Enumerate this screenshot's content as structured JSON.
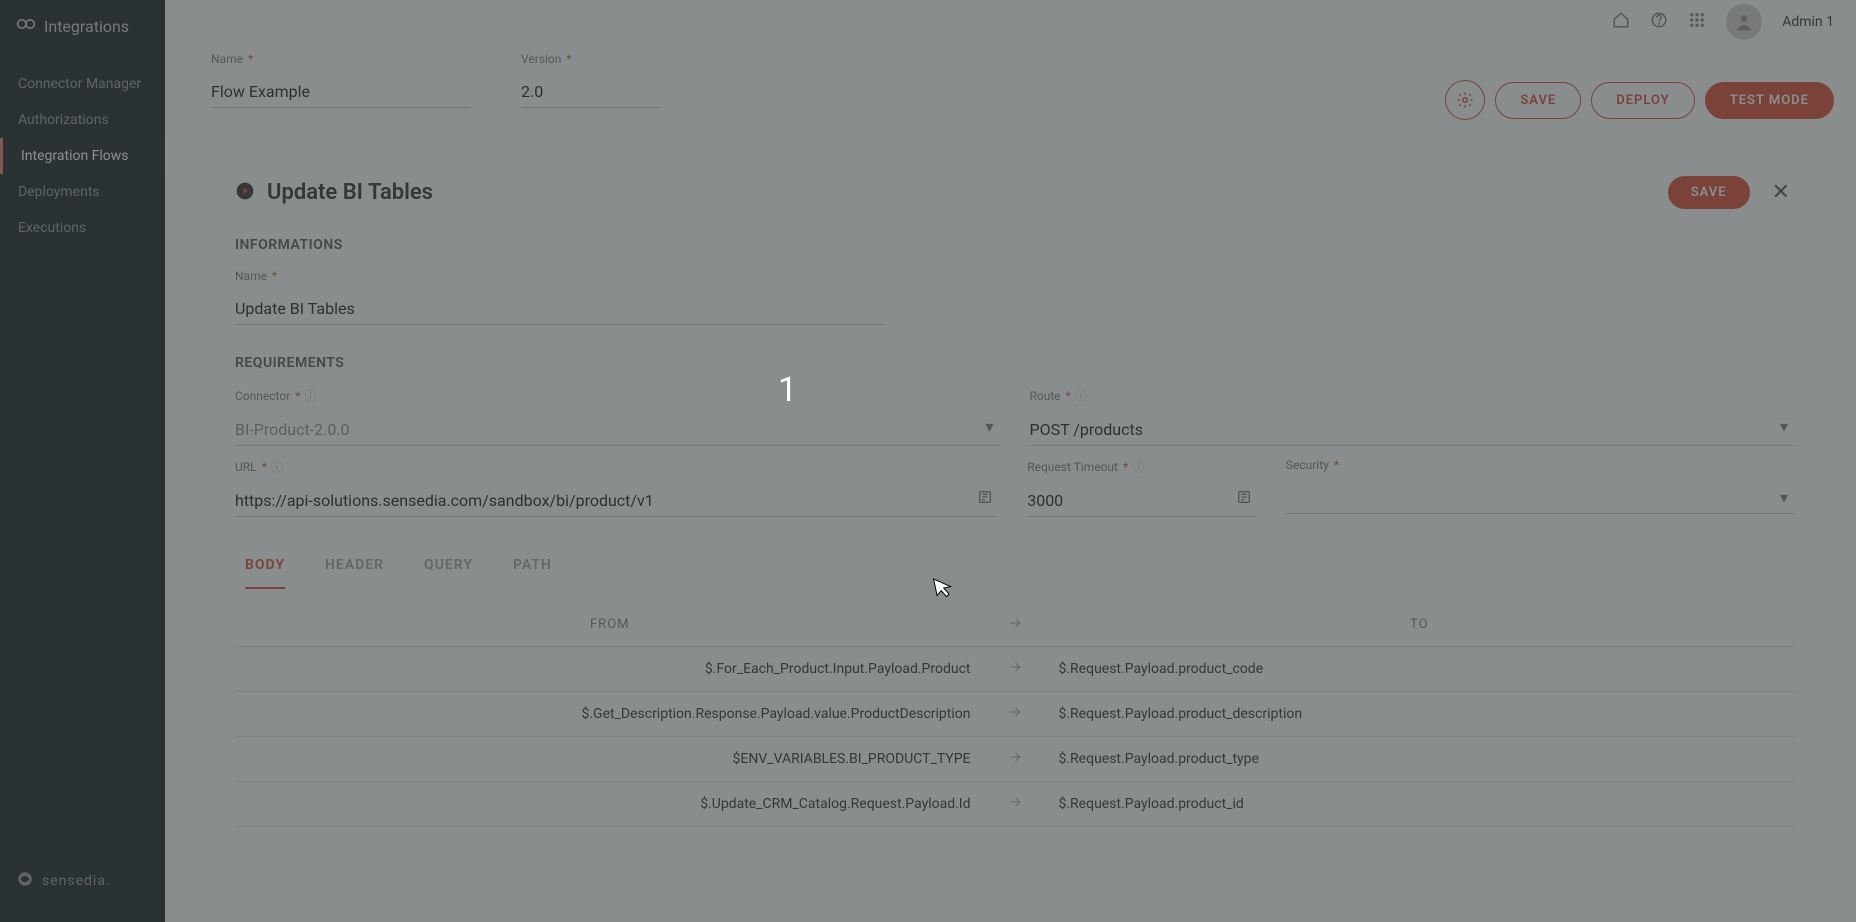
{
  "brand": {
    "name": "Integrations",
    "footer": "sensedia."
  },
  "sidebar": {
    "items": [
      {
        "label": "Connector Manager"
      },
      {
        "label": "Authorizations"
      },
      {
        "label": "Integration Flows"
      },
      {
        "label": "Deployments"
      },
      {
        "label": "Executions"
      }
    ]
  },
  "topbar": {
    "user": "Admin 1"
  },
  "header": {
    "name_label": "Name",
    "name_value": "Flow Example",
    "version_label": "Version",
    "version_value": "2.0",
    "save": "SAVE",
    "deploy": "DEPLOY",
    "test_mode": "TEST MODE"
  },
  "panel": {
    "title": "Update BI Tables",
    "save": "SAVE",
    "informations": {
      "heading": "INFORMATIONS",
      "name_label": "Name",
      "name_value": "Update BI Tables"
    },
    "requirements": {
      "heading": "REQUIREMENTS",
      "connector_label": "Connector",
      "connector_value": "BI-Product-2.0.0",
      "route_label": "Route",
      "route_value": "POST /products",
      "url_label": "URL",
      "url_value": "https://api-solutions.sensedia.com/sandbox/bi/product/v1",
      "timeout_label": "Request Timeout",
      "timeout_value": "3000",
      "security_label": "Security",
      "security_value": ""
    },
    "tabs": [
      "BODY",
      "HEADER",
      "QUERY",
      "PATH"
    ],
    "mapping": {
      "from_header": "FROM",
      "to_header": "TO",
      "rows": [
        {
          "from": "$.For_Each_Product.Input.Payload.Product",
          "to": "$.Request.Payload.product_code"
        },
        {
          "from": "$.Get_Description.Response.Payload.value.ProductDescription",
          "to": "$.Request.Payload.product_description"
        },
        {
          "from": "$ENV_VARIABLES.BI_PRODUCT_TYPE",
          "to": "$.Request.Payload.product_type"
        },
        {
          "from": "$.Update_CRM_Catalog.Request.Payload.Id",
          "to": "$.Request.Payload.product_id"
        }
      ]
    }
  },
  "overlay": {
    "marker": "1"
  }
}
